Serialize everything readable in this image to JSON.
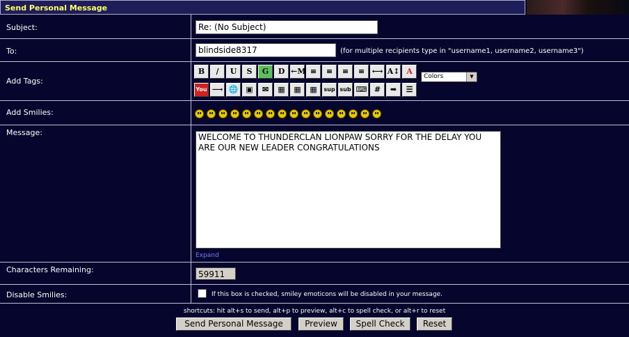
{
  "header": {
    "title": "Send Personal Message"
  },
  "subject": {
    "label": "Subject:",
    "value": "Re: (No Subject)"
  },
  "to": {
    "label": "To:",
    "value": "blindside8317",
    "hint": "(for multiple recipients type in \"username1, username2, username3\")"
  },
  "tags": {
    "label": "Add Tags:",
    "row1": [
      {
        "name": "bold-button",
        "glyph": "B"
      },
      {
        "name": "italic-button",
        "glyph": "/"
      },
      {
        "name": "underline-button",
        "glyph": "U"
      },
      {
        "name": "strike-button",
        "glyph": "S"
      },
      {
        "name": "glow-button",
        "glyph": "G"
      },
      {
        "name": "shadow-button",
        "glyph": "D"
      },
      {
        "name": "move-button",
        "glyph": "←M"
      },
      {
        "name": "align-left-button",
        "glyph": "≡"
      },
      {
        "name": "align-center-button",
        "glyph": "≡"
      },
      {
        "name": "align-center2-button",
        "glyph": "≡"
      },
      {
        "name": "align-right-button",
        "glyph": "≡"
      },
      {
        "name": "horizontal-rule-button",
        "glyph": "⟷"
      },
      {
        "name": "font-size-button",
        "glyph": "A↕"
      },
      {
        "name": "font-color-button",
        "glyph": "A"
      }
    ],
    "row2": [
      {
        "name": "youtube-button",
        "glyph": "You"
      },
      {
        "name": "arrow-button",
        "glyph": "⟶"
      },
      {
        "name": "link-button",
        "glyph": "🌐"
      },
      {
        "name": "image-button",
        "glyph": "▣"
      },
      {
        "name": "email-button",
        "glyph": "✉"
      },
      {
        "name": "table-button",
        "glyph": "▦"
      },
      {
        "name": "table-row-button",
        "glyph": "▦"
      },
      {
        "name": "table-cell-button",
        "glyph": "▦"
      },
      {
        "name": "superscript-button",
        "glyph": "sup"
      },
      {
        "name": "subscript-button",
        "glyph": "sub"
      },
      {
        "name": "teletype-button",
        "glyph": "⌨"
      },
      {
        "name": "code-button",
        "glyph": "#"
      },
      {
        "name": "quote-button",
        "glyph": "➡"
      },
      {
        "name": "list-button",
        "glyph": "☰"
      }
    ],
    "colors": "Colors"
  },
  "smilies": {
    "label": "Add Smilies:",
    "names": [
      "smiley-icon",
      "grin-icon",
      "cheesy-icon",
      "laugh-icon",
      "angry-icon",
      "sad-icon",
      "shocked-icon",
      "cool-icon",
      "huh-icon",
      "rolleyes-icon",
      "tongue-icon",
      "embarrassed-icon",
      "lipsrsealed-icon",
      "undecided-icon",
      "kiss-icon",
      "cry-icon"
    ]
  },
  "message": {
    "label": "Message:",
    "text": "WELCOME TO THUNDERCLAN LIONPAW SORRY FOR THE DELAY YOU ARE OUR NEW LEADER CONGRATULATIONS",
    "expand": "Expand"
  },
  "chars": {
    "label": "Characters Remaining:",
    "value": "59911"
  },
  "disable_smilies": {
    "label": "Disable Smilies:",
    "text": "If this box is checked, smiley emoticons will be disabled in your message."
  },
  "footer": {
    "shortcuts": "shortcuts: hit alt+s to send, alt+p to preview, alt+c to spell check, or alt+r to reset",
    "send": "Send Personal Message",
    "preview": "Preview",
    "spell": "Spell Check",
    "reset": "Reset"
  },
  "colors": {
    "background": "#05052e",
    "header_text": "#ffff66"
  }
}
